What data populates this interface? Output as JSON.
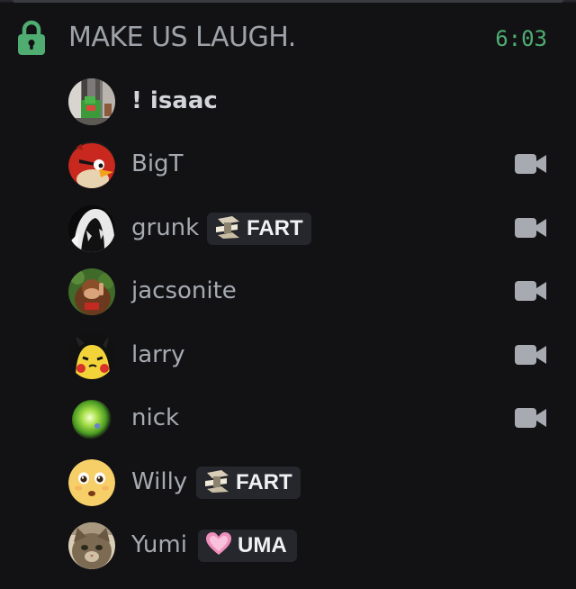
{
  "channel": {
    "name": "MAKE US LAUGH.",
    "icon": "lock-icon",
    "timer": "6:03",
    "accent": "#4fad72"
  },
  "users": [
    {
      "name": "! isaac",
      "bold": true,
      "badge": null,
      "camera": false,
      "avatar": "pixel-art-avatar"
    },
    {
      "name": "BigT",
      "bold": false,
      "badge": null,
      "camera": true,
      "avatar": "red-bird-avatar"
    },
    {
      "name": "grunk",
      "bold": false,
      "badge": {
        "label": "FART",
        "icon": "tan-emblem-icon"
      },
      "camera": true,
      "avatar": "masked-figure-avatar"
    },
    {
      "name": "jacsonite",
      "bold": false,
      "badge": null,
      "camera": true,
      "avatar": "ape-avatar"
    },
    {
      "name": "larry",
      "bold": false,
      "badge": null,
      "camera": true,
      "avatar": "yellow-creature-avatar"
    },
    {
      "name": "nick",
      "bold": false,
      "badge": null,
      "camera": true,
      "avatar": "green-orb-avatar"
    },
    {
      "name": "Willy",
      "bold": false,
      "badge": {
        "label": "FART",
        "icon": "tan-emblem-icon"
      },
      "camera": false,
      "avatar": "smiley-face-avatar"
    },
    {
      "name": "Yumi",
      "bold": false,
      "badge": {
        "label": "UMA",
        "icon": "pink-heart-icon"
      },
      "camera": false,
      "avatar": "cat-avatar"
    }
  ]
}
